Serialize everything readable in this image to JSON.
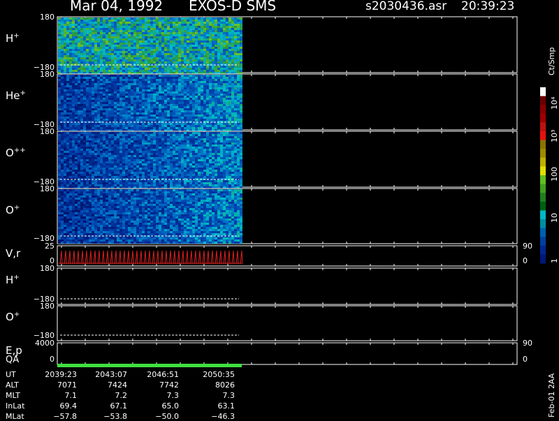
{
  "header": {
    "date": "Mar 04, 1992",
    "instrument": "EXOS-D SMS",
    "file": "s2030436.asr",
    "time": "20:39:23"
  },
  "panels": [
    {
      "label": "H",
      "sup": "+",
      "ytop": "180",
      "ybot": "−180",
      "type": "spectrogram",
      "base": 0.55
    },
    {
      "label": "He",
      "sup": "+",
      "ytop": "180",
      "ybot": "−180",
      "type": "spectrogram",
      "base": 0.2
    },
    {
      "label": "O",
      "sup": "++",
      "ytop": "180",
      "ybot": "−180",
      "type": "spectrogram",
      "base": 0.18
    },
    {
      "label": "O",
      "sup": "+",
      "ytop": "180",
      "ybot": "−180",
      "type": "spectrogram",
      "base": 0.17
    },
    {
      "label": "V,r",
      "sup": "",
      "ytop": "25",
      "ybot": "0",
      "right_top": "90",
      "right_bot": "0",
      "type": "sawtooth"
    },
    {
      "label": "H",
      "sup": "+",
      "ytop": "180",
      "ybot": "−180",
      "type": "empty"
    },
    {
      "label": "O",
      "sup": "+",
      "ytop": "180",
      "ybot": "−180",
      "type": "empty"
    },
    {
      "label": "E,p",
      "sup": "",
      "ytop": "4000",
      "ybot": "0",
      "right_top": "90",
      "right_bot": "0",
      "type": "ep"
    }
  ],
  "qa_label": "QA",
  "colorbar": {
    "unit": "Ct/Smp",
    "ticks": [
      "10⁴",
      "10³",
      "100",
      "10",
      "1"
    ],
    "colors": [
      "#ffffff",
      "#6b0000",
      "#8b0000",
      "#a00000",
      "#c01010",
      "#e81010",
      "#8a7400",
      "#a08c00",
      "#c0b000",
      "#e0e000",
      "#60c020",
      "#40a020",
      "#208020",
      "#006010",
      "#00b8c8",
      "#0090a0",
      "#0060b0",
      "#0040a0",
      "#002890",
      "#001878"
    ]
  },
  "ephemeris": {
    "labels": [
      "UT",
      "ALT",
      "MLT",
      "InLat",
      "MLat"
    ],
    "columns": [
      [
        "2039:23",
        "7071",
        "7.1",
        "69.4",
        "−57.8"
      ],
      [
        "2043:07",
        "7424",
        "7.2",
        "67.1",
        "−53.8"
      ],
      [
        "2046:51",
        "7742",
        "7.3",
        "65.0",
        "−50.0"
      ],
      [
        "2050:35",
        "8026",
        "7.3",
        "63.1",
        "−46.3"
      ]
    ]
  },
  "footer": "Feb-01 2AA",
  "chart_data": {
    "type": "heatmap",
    "title": "Mar 04, 1992 EXOS-D SMS",
    "x_ticks": [
      "2039:23",
      "2043:07",
      "2046:51",
      "2050:35"
    ],
    "panels": [
      "H+",
      "He+",
      "O++",
      "O+",
      "V,r",
      "H+",
      "O+",
      "E,p",
      "QA"
    ],
    "y_range_pitch": [
      -180,
      180
    ],
    "colorbar_unit": "Ct/Smp",
    "colorbar_range": [
      1,
      10000
    ],
    "colorbar_scale": "log"
  }
}
